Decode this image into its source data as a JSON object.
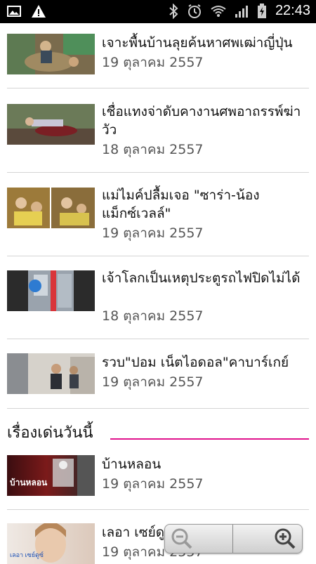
{
  "status_bar": {
    "time": "22:43"
  },
  "articles": [
    {
      "title": "เจาะพื้นบ้านลุยค้นหาศพเฒ่าญี่ปุ่น",
      "date": "19 ตุลาคม 2557"
    },
    {
      "title": "เชื่อแทงจ่าดับคางานศพอาถรรพ์ฆ่าวัว",
      "date": "18 ตุลาคม 2557"
    },
    {
      "title": "แม่ไมค์ปลื้มเจอ \"ซาร่า-น้องแม็กซ์เวลล์\"",
      "date": "19 ตุลาคม 2557"
    },
    {
      "title": "เจ้าโลกเป็นเหตุประตูรถไฟปิดไม่ได้",
      "date": "18 ตุลาคม 2557"
    },
    {
      "title": "รวบ\"ปอม เน็ตไอดอล\"คาบาร์เกย์",
      "date": "19 ตุลาคม 2557"
    }
  ],
  "section": {
    "title": "เรื่องเด่นวันนี้"
  },
  "featured": [
    {
      "title": "บ้านหลอน",
      "date": "19 ตุลาคม 2557",
      "thumb_text": "บ้านหลอน"
    },
    {
      "title": "เลอา เซย์ดูซ์",
      "date": "19 ตุลาคม 2557",
      "thumb_text": "เลอา เซย์ดูซ์"
    }
  ]
}
